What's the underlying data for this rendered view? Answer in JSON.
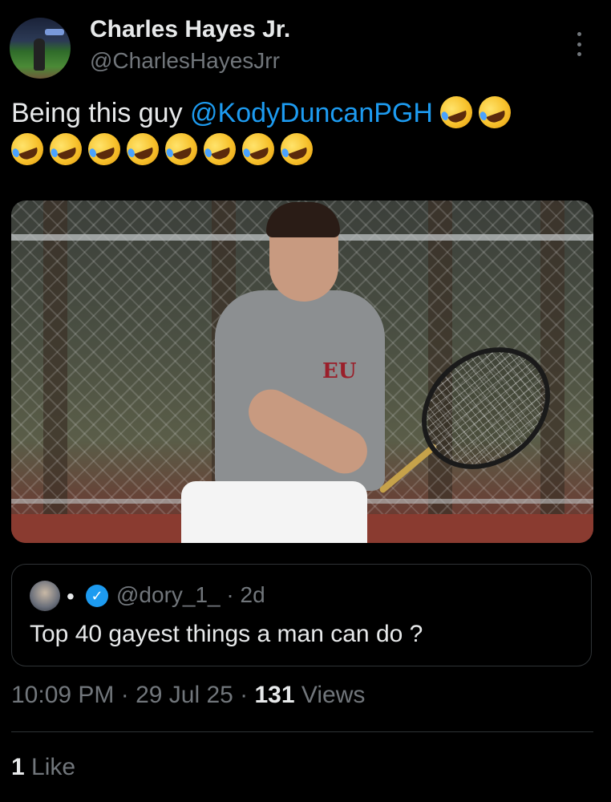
{
  "author": {
    "name": "Charles Hayes Jr.",
    "handle": "@CharlesHayesJrr"
  },
  "tweet": {
    "text_prefix": "Being this guy ",
    "mention": "@KodyDuncanPGH",
    "emoji_icon": "rolling-on-the-floor-laughing-emoji",
    "emoji_count": 10,
    "media_logo_text": "EU"
  },
  "quoted": {
    "separator": "•",
    "verified_glyph": "✓",
    "handle_time": "@dory_1_ · 2d",
    "text": "Top 40 gayest things a man can do ?"
  },
  "meta": {
    "timestamp": "10:09 PM · 29 Jul 25 · ",
    "views_count": "131",
    "views_label": " Views"
  },
  "engagement": {
    "like_count": "1",
    "like_label": " Like"
  },
  "colors": {
    "background": "#000000",
    "text": "#e7e9ea",
    "secondary": "#71767b",
    "accent": "#1d9bf0",
    "border": "#2f3336"
  }
}
